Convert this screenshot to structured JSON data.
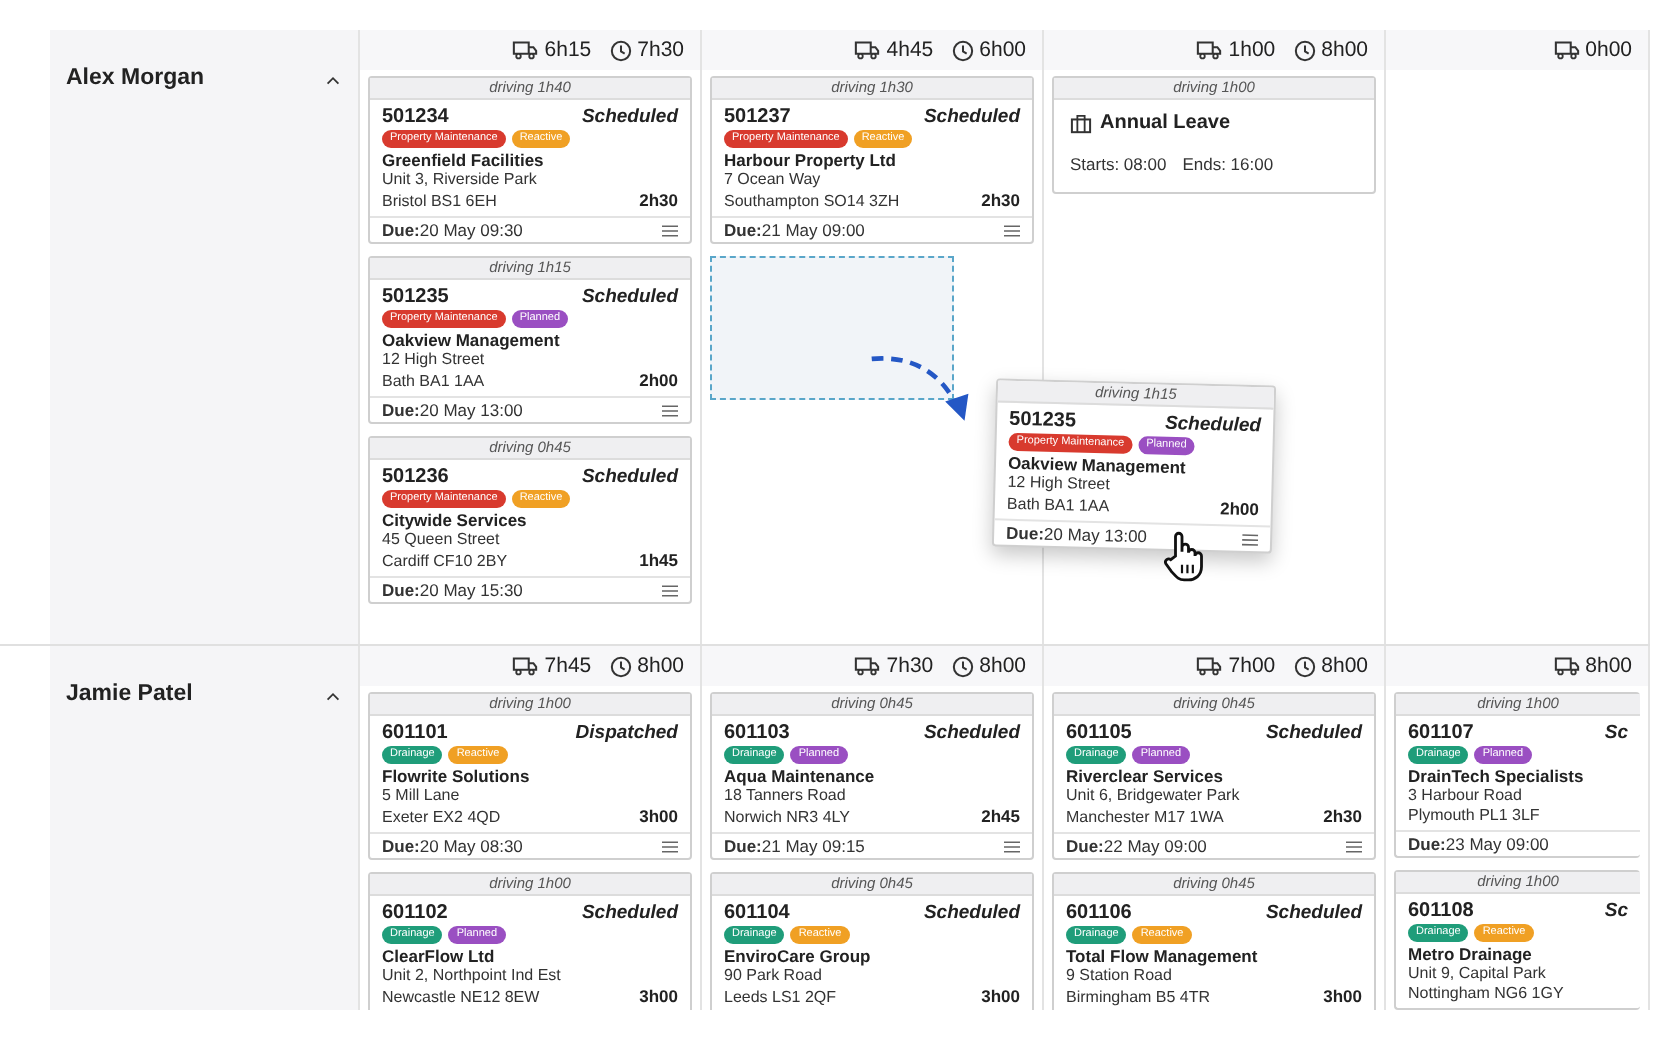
{
  "resources": [
    {
      "name": "Alex Morgan",
      "expanded": true,
      "days": [
        {
          "driving": "6h15",
          "clock": "7h30",
          "items": [
            {
              "kind": "job",
              "driving": "driving 1h40",
              "id": "501234",
              "status": "Scheduled",
              "tags": [
                {
                  "label": "Property Maintenance",
                  "color": "#d83a2e"
                },
                {
                  "label": "Reactive",
                  "color": "#f0a024"
                }
              ],
              "client": "Greenfield Facilities",
              "address": [
                "Unit 3, Riverside Park",
                "Bristol BS1 6EH"
              ],
              "duration": "2h30",
              "due": "**Due:**20 May 09:30",
              "menu": true
            },
            {
              "kind": "job",
              "driving": "driving 1h15",
              "id": "501235",
              "status": "Scheduled",
              "tags": [
                {
                  "label": "Property Maintenance",
                  "color": "#d83a2e"
                },
                {
                  "label": "Planned",
                  "color": "#9a4fc2"
                }
              ],
              "client": "Oakview Management",
              "address": [
                "12 High Street",
                "Bath BA1 1AA"
              ],
              "duration": "2h00",
              "due": "**Due:**20 May 13:00",
              "menu": true
            },
            {
              "kind": "job",
              "driving": "driving 0h45",
              "id": "501236",
              "status": "Scheduled",
              "tags": [
                {
                  "label": "Property Maintenance",
                  "color": "#d83a2e"
                },
                {
                  "label": "Reactive",
                  "color": "#f0a024"
                }
              ],
              "client": "Citywide Services",
              "address": [
                "45 Queen Street",
                "Cardiff CF10 2BY"
              ],
              "duration": "1h45",
              "due": "**Due:**20 May 15:30",
              "menu": true
            }
          ]
        },
        {
          "driving": "4h45",
          "clock": "6h00",
          "items": [
            {
              "kind": "job",
              "driving": "driving 1h30",
              "id": "501237",
              "status": "Scheduled",
              "tags": [
                {
                  "label": "Property Maintenance",
                  "color": "#d83a2e"
                },
                {
                  "label": "Reactive",
                  "color": "#f0a024"
                }
              ],
              "client": "Harbour Property Ltd",
              "address": [
                "7 Ocean Way",
                "Southampton SO14 3ZH"
              ],
              "duration": "2h30",
              "due": "**Due:**21 May 09:00",
              "menu": true
            },
            {
              "kind": "drop-zone"
            }
          ]
        },
        {
          "driving": "1h00",
          "clock": "8h00",
          "items": [
            {
              "kind": "leave",
              "driving": "driving 1h00",
              "title": "Annual Leave",
              "starts": "Starts: 08:00",
              "ends": "Ends: 16:00"
            }
          ]
        },
        {
          "driving": "0h00"
        }
      ],
      "drag_card": {
        "kind": "job",
        "driving": "driving 1h15",
        "id": "501235",
        "status": "Scheduled",
        "tags": [
          {
            "label": "Property Maintenance",
            "color": "#d83a2e"
          },
          {
            "label": "Planned",
            "color": "#9a4fc2"
          }
        ],
        "client": "Oakview Management",
        "address": [
          "12 High Street",
          "Bath BA1 1AA"
        ],
        "duration": "2h00",
        "due": "**Due:**20 May 13:00",
        "menu": true
      }
    },
    {
      "name": "Jamie Patel",
      "expanded": true,
      "days": [
        {
          "driving": "7h45",
          "clock": "8h00",
          "items": [
            {
              "kind": "job",
              "driving": "driving 1h00",
              "id": "601101",
              "status": "Dispatched",
              "tags": [
                {
                  "label": "Drainage",
                  "color": "#1f9d7a"
                },
                {
                  "label": "Reactive",
                  "color": "#f0a024"
                }
              ],
              "client": "Flowrite Solutions",
              "address": [
                "5 Mill Lane",
                "Exeter EX2 4QD"
              ],
              "duration": "3h00",
              "due": "**Due:**20 May 08:30",
              "menu": true
            },
            {
              "kind": "job",
              "driving": "driving 1h00",
              "id": "601102",
              "status": "Scheduled",
              "tags": [
                {
                  "label": "Drainage",
                  "color": "#1f9d7a"
                },
                {
                  "label": "Planned",
                  "color": "#9a4fc2"
                }
              ],
              "client": "ClearFlow Ltd",
              "address": [
                "Unit 2, Northpoint Ind Est",
                "Newcastle NE12 8EW"
              ],
              "duration": "3h00"
            }
          ]
        },
        {
          "driving": "7h30",
          "clock": "8h00",
          "items": [
            {
              "kind": "job",
              "driving": "driving 0h45",
              "id": "601103",
              "status": "Scheduled",
              "tags": [
                {
                  "label": "Drainage",
                  "color": "#1f9d7a"
                },
                {
                  "label": "Planned",
                  "color": "#9a4fc2"
                }
              ],
              "client": "Aqua Maintenance",
              "address": [
                "18 Tanners Road",
                "Norwich NR3 4LY"
              ],
              "duration": "2h45",
              "due": "**Due:**21 May 09:15",
              "menu": true
            },
            {
              "kind": "job",
              "driving": "driving 0h45",
              "id": "601104",
              "status": "Scheduled",
              "tags": [
                {
                  "label": "Drainage",
                  "color": "#1f9d7a"
                },
                {
                  "label": "Reactive",
                  "color": "#f0a024"
                }
              ],
              "client": "EnviroCare Group",
              "address": [
                "90 Park Road",
                "Leeds LS1 2QF"
              ],
              "duration": "3h00"
            }
          ]
        },
        {
          "driving": "7h00",
          "clock": "8h00",
          "items": [
            {
              "kind": "job",
              "driving": "driving 0h45",
              "id": "601105",
              "status": "Scheduled",
              "tags": [
                {
                  "label": "Drainage",
                  "color": "#1f9d7a"
                },
                {
                  "label": "Planned",
                  "color": "#9a4fc2"
                }
              ],
              "client": "Riverclear Services",
              "address": [
                "Unit 6, Bridgewater Park",
                "Manchester M17 1WA"
              ],
              "duration": "2h30",
              "due": "**Due:**22 May 09:00",
              "menu": true
            },
            {
              "kind": "job",
              "driving": "driving 0h45",
              "id": "601106",
              "status": "Scheduled",
              "tags": [
                {
                  "label": "Drainage",
                  "color": "#1f9d7a"
                },
                {
                  "label": "Reactive",
                  "color": "#f0a024"
                }
              ],
              "client": "Total Flow Management",
              "address": [
                "9 Station Road",
                "Birmingham B5 4TR"
              ],
              "duration": "3h00"
            }
          ]
        },
        {
          "driving": "8h00",
          "items": [
            {
              "kind": "job",
              "driving": "driving 1h00",
              "id": "601107",
              "status": "Sc",
              "tags": [
                {
                  "label": "Drainage",
                  "color": "#1f9d7a"
                },
                {
                  "label": "Planned",
                  "color": "#9a4fc2"
                }
              ],
              "client": "DrainTech Specialists",
              "address": [
                "3 Harbour Road",
                "Plymouth PL1 3LF"
              ],
              "due": "**Due:**23 May 09:00",
              "menu": false
            },
            {
              "kind": "job",
              "driving": "driving 1h00",
              "id": "601108",
              "status": "Sc",
              "tags": [
                {
                  "label": "Drainage",
                  "color": "#1f9d7a"
                },
                {
                  "label": "Reactive",
                  "color": "#f0a024"
                }
              ],
              "client": "Metro Drainage",
              "address": [
                "Unit 9, Capital Park",
                "Nottingham NG6 1GY"
              ]
            }
          ]
        }
      ]
    }
  ]
}
